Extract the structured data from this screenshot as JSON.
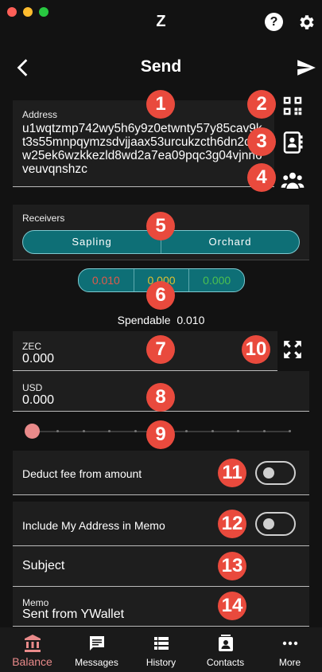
{
  "window": {
    "app_letter": "Z"
  },
  "appbar": {
    "title": "Send"
  },
  "address": {
    "label": "Address",
    "value": "u1wqtzmp742wy5h6y9z0etwnty57y85cav9kt3s55mnpqymzsdvjjaax53urcukzcth6dn2cqsw25ek6wzkkezld8wd2a7ea09pqc3g04vjnn6veuvqnshzc"
  },
  "receivers": {
    "label": "Receivers",
    "options": [
      "Sapling",
      "Orchard"
    ]
  },
  "pools": [
    {
      "value": "0.010",
      "color": "#e05a4a"
    },
    {
      "value": "0.000",
      "color": "#e0c030"
    },
    {
      "value": "0.000",
      "color": "#4cc050"
    }
  ],
  "spendable": {
    "label": "Spendable",
    "value": "0.010"
  },
  "zec": {
    "label": "ZEC",
    "value": "0.000"
  },
  "usd": {
    "label": "USD",
    "value": "0.000"
  },
  "slider": {
    "value_percent": 0
  },
  "deduct_fee": {
    "label": "Deduct fee from amount",
    "on": false
  },
  "include_address": {
    "label": "Include My Address in Memo",
    "on": false
  },
  "subject": {
    "placeholder": "Subject"
  },
  "memo": {
    "label": "Memo",
    "value": "Sent from YWallet"
  },
  "badges": [
    "1",
    "2",
    "3",
    "4",
    "5",
    "6",
    "7",
    "8",
    "9",
    "10",
    "11",
    "12",
    "13",
    "14"
  ],
  "nav": [
    {
      "label": "Balance",
      "icon": "bank-icon",
      "active": true
    },
    {
      "label": "Messages",
      "icon": "message-icon",
      "active": false
    },
    {
      "label": "History",
      "icon": "list-icon",
      "active": false
    },
    {
      "label": "Contacts",
      "icon": "contact-card-icon",
      "active": false
    },
    {
      "label": "More",
      "icon": "more-dots-icon",
      "active": false
    }
  ],
  "colors": {
    "accent": "#e98a8a",
    "teal": "#0e6f76",
    "badge": "#e94a3d",
    "background": "#121212"
  }
}
